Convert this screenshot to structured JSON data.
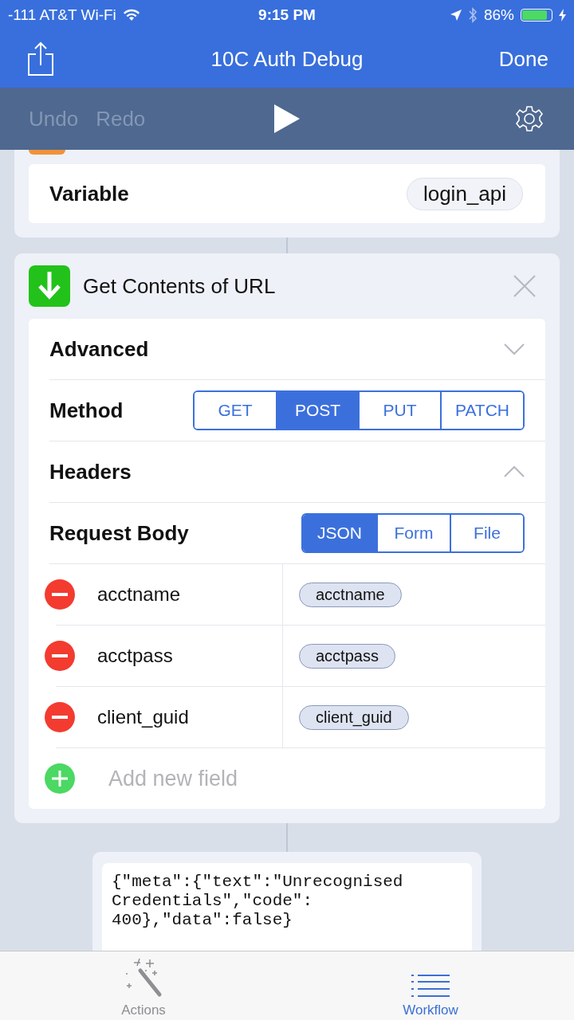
{
  "status_bar": {
    "carrier": "-111 AT&T Wi-Fi",
    "time": "9:15 PM",
    "battery": "86%"
  },
  "nav": {
    "title": "10C Auth Debug",
    "done": "Done"
  },
  "toolbar": {
    "undo": {
      "label": "Undo",
      "disabled": true
    },
    "redo": {
      "label": "Redo",
      "disabled": true
    }
  },
  "variable_card": {
    "label": "Variable",
    "value": "login_api"
  },
  "action_card": {
    "title": "Get Contents of URL",
    "advanced": {
      "label": "Advanced",
      "expanded": false
    },
    "method": {
      "label": "Method",
      "options": [
        {
          "label": "GET",
          "selected": false
        },
        {
          "label": "POST",
          "selected": true
        },
        {
          "label": "PUT",
          "selected": false
        },
        {
          "label": "PATCH",
          "selected": false
        }
      ]
    },
    "headers": {
      "label": "Headers",
      "expanded": true
    },
    "request_body": {
      "label": "Request Body",
      "options": [
        {
          "label": "JSON",
          "selected": true
        },
        {
          "label": "Form",
          "selected": false
        },
        {
          "label": "File",
          "selected": false
        }
      ]
    },
    "fields": [
      {
        "key": "acctname",
        "value": "acctname"
      },
      {
        "key": "acctpass",
        "value": "acctpass"
      },
      {
        "key": "client_guid",
        "value": "client_guid"
      }
    ],
    "add_field": {
      "placeholder": "Add new field"
    }
  },
  "output": {
    "text": "{\"meta\":{\"text\":\"Unrecognised Credentials\",\"code\": 400},\"data\":false}"
  },
  "tabs": [
    {
      "label": "Actions",
      "kind": "actions",
      "selected": false
    },
    {
      "label": "Workflow",
      "kind": "workflow",
      "selected": true
    }
  ]
}
